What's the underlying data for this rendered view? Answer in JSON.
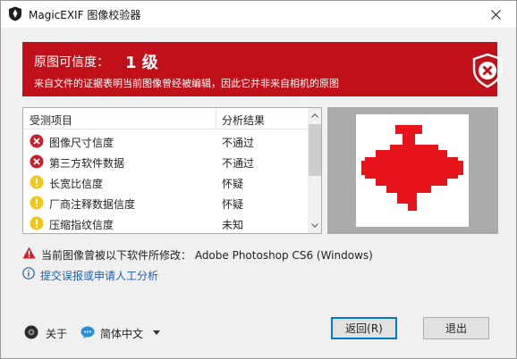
{
  "window": {
    "title": "MagicEXIF 图像校验器"
  },
  "banner": {
    "credibility_label": "原图可信度：",
    "grade": "1 级",
    "message": "来自文件的证据表明当前图像曾经被编辑，因此它并非来自相机的原图",
    "background_color": "#c0111b",
    "icon": "shield-x-icon"
  },
  "table": {
    "headers": [
      "受测项目",
      "分析结果"
    ],
    "rows": [
      {
        "item": "图像尺寸信度",
        "result": "不通过",
        "status_icon": "error-icon"
      },
      {
        "item": "第三方软件数据",
        "result": "不通过",
        "status_icon": "error-icon"
      },
      {
        "item": "长宽比信度",
        "result": "怀疑",
        "status_icon": "warning-icon"
      },
      {
        "item": "厂商注释数据信度",
        "result": "怀疑",
        "status_icon": "warning-icon"
      },
      {
        "item": "压缩指纹信度",
        "result": "未知",
        "status_icon": "warning-icon"
      }
    ]
  },
  "preview": {
    "icon": "red-pipe-thumbnail",
    "color": "#e8141c"
  },
  "warning": {
    "text": "当前图像曾被以下软件所修改：  Adobe Photoshop CS6 (Windows)",
    "icon": "warning-triangle-icon"
  },
  "link": {
    "text": "提交误报或申请人工分析",
    "icon": "info-icon"
  },
  "footer": {
    "about_label": "关于",
    "language": "简体中文",
    "back_button": "返回(R)",
    "exit_button": "退出"
  }
}
